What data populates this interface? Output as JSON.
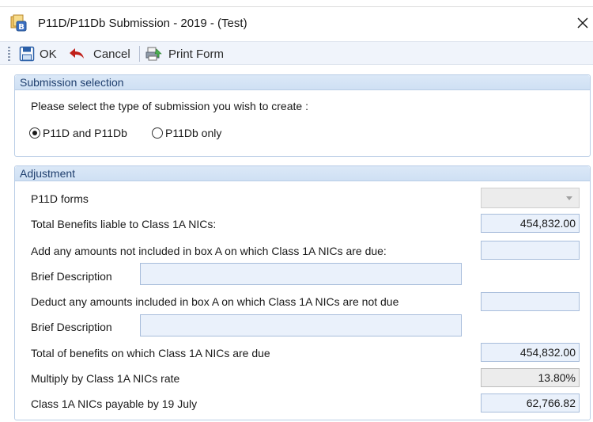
{
  "window": {
    "title": "P11D/P11Db Submission - 2019 - (Test)",
    "app_icon": "b-badge-app-icon",
    "close_icon": "close-icon"
  },
  "toolbar": {
    "ok_label": "OK",
    "cancel_label": "Cancel",
    "print_label": "Print Form"
  },
  "submission": {
    "header": "Submission selection",
    "prompt": "Please select the type of submission you wish to create :",
    "options": [
      {
        "label": "P11D and P11Db",
        "selected": true
      },
      {
        "label": "P11Db only",
        "selected": false
      }
    ]
  },
  "adjustment": {
    "header": "Adjustment",
    "p11d_forms_label": "P11D forms",
    "p11d_forms_value": "",
    "total_benefits_label": "Total Benefits liable to Class 1A NICs:",
    "total_benefits_value": "454,832.00",
    "add_amounts_label": "Add any amounts not included in box A on which Class 1A NICs are due:",
    "add_amounts_value": "",
    "brief_desc_1_label": "Brief Description",
    "brief_desc_1_value": "",
    "deduct_amounts_label": "Deduct any amounts included in box A on which Class 1A NICs are not due",
    "deduct_amounts_value": "",
    "brief_desc_2_label": "Brief Description",
    "brief_desc_2_value": "",
    "total_due_label": "Total of benefits on which Class 1A NICs are due",
    "total_due_value": "454,832.00",
    "rate_label": "Multiply by Class 1A NICs rate",
    "rate_value": "13.80%",
    "payable_label": "Class 1A NICs payable by 19 July",
    "payable_value": "62,766.82"
  },
  "colors": {
    "toolbar_bg": "#f0f4fb",
    "group_header_bg": "#d5e4f5",
    "field_bg": "#eaf1fb",
    "cancel_arrow": "#c0201a",
    "save_icon": "#2a5fa8"
  }
}
